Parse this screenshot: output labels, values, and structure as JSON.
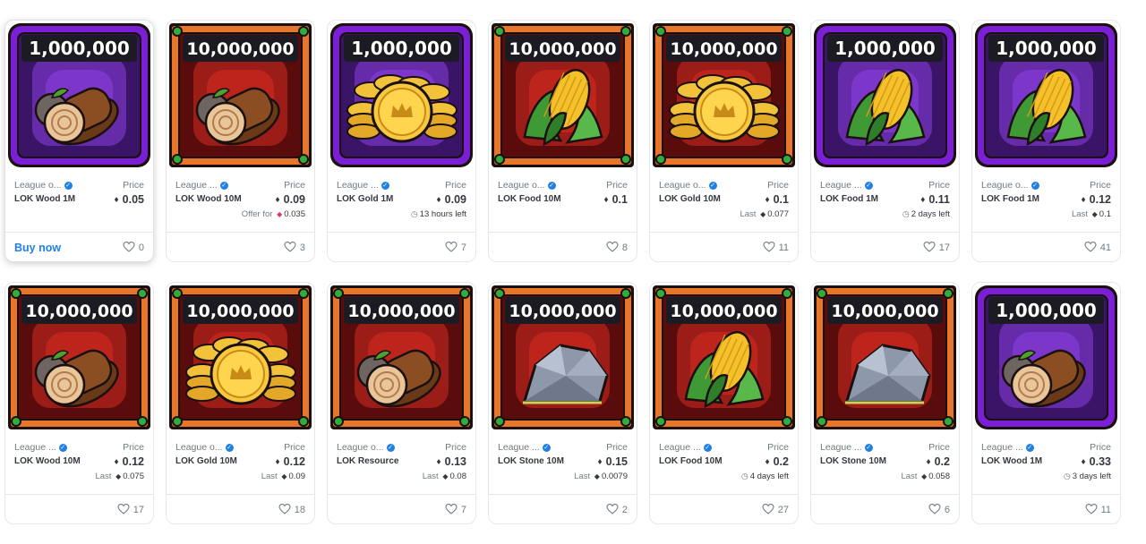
{
  "colors": {
    "accent": "#2081e2",
    "purple_frame": "#7b1fd6",
    "orange_frame": "#e8762a"
  },
  "rows": [
    [
      {
        "quantity": "1,000,000",
        "frame": "purple",
        "resource": "wood",
        "collection": "League o...",
        "name": "LOK Wood 1M",
        "price_label": "Price",
        "price": "0.05",
        "sub_prefix": "",
        "sub_value": "",
        "sub_icon": "",
        "footer_action": "Buy now",
        "likes": "0",
        "hover": true
      },
      {
        "quantity": "10,000,000",
        "frame": "orange",
        "resource": "wood",
        "collection": "League ...",
        "name": "LOK Wood 10M",
        "price_label": "Price",
        "price": "0.09",
        "sub_prefix": "Offer for",
        "sub_value": "0.035",
        "sub_icon": "weth-icon",
        "footer_action": "",
        "likes": "3",
        "hover": false
      },
      {
        "quantity": "1,000,000",
        "frame": "purple",
        "resource": "gold",
        "collection": "League ...",
        "name": "LOK Gold 1M",
        "price_label": "Price",
        "price": "0.09",
        "sub_prefix": "",
        "sub_value": "13 hours left",
        "sub_icon": "clock-icon",
        "footer_action": "",
        "likes": "7",
        "hover": false
      },
      {
        "quantity": "10,000,000",
        "frame": "orange",
        "resource": "food",
        "collection": "League o...",
        "name": "LOK Food 10M",
        "price_label": "Price",
        "price": "0.1",
        "sub_prefix": "",
        "sub_value": "",
        "sub_icon": "",
        "footer_action": "",
        "likes": "8",
        "hover": false
      },
      {
        "quantity": "10,000,000",
        "frame": "orange",
        "resource": "gold",
        "collection": "League o...",
        "name": "LOK Gold 10M",
        "price_label": "Price",
        "price": "0.1",
        "sub_prefix": "Last",
        "sub_value": "0.077",
        "sub_icon": "eth-icon",
        "footer_action": "",
        "likes": "11",
        "hover": false
      },
      {
        "quantity": "1,000,000",
        "frame": "purple",
        "resource": "food",
        "collection": "League ...",
        "name": "LOK Food 1M",
        "price_label": "Price",
        "price": "0.11",
        "sub_prefix": "",
        "sub_value": "2 days left",
        "sub_icon": "clock-icon",
        "footer_action": "",
        "likes": "17",
        "hover": false
      },
      {
        "quantity": "1,000,000",
        "frame": "purple",
        "resource": "food",
        "collection": "League o...",
        "name": "LOK Food 1M",
        "price_label": "Price",
        "price": "0.12",
        "sub_prefix": "Last",
        "sub_value": "0.1",
        "sub_icon": "eth-icon",
        "footer_action": "",
        "likes": "41",
        "hover": false
      }
    ],
    [
      {
        "quantity": "10,000,000",
        "frame": "orange",
        "resource": "wood",
        "collection": "League ...",
        "name": "LOK Wood 10M",
        "price_label": "Price",
        "price": "0.12",
        "sub_prefix": "Last",
        "sub_value": "0.075",
        "sub_icon": "eth-icon",
        "footer_action": "",
        "likes": "17",
        "hover": false
      },
      {
        "quantity": "10,000,000",
        "frame": "orange",
        "resource": "gold",
        "collection": "League o...",
        "name": "LOK Gold 10M",
        "price_label": "Price",
        "price": "0.12",
        "sub_prefix": "Last",
        "sub_value": "0.09",
        "sub_icon": "eth-icon",
        "footer_action": "",
        "likes": "18",
        "hover": false
      },
      {
        "quantity": "10,000,000",
        "frame": "orange",
        "resource": "wood",
        "collection": "League o...",
        "name": "LOK Resource",
        "price_label": "Price",
        "price": "0.13",
        "sub_prefix": "Last",
        "sub_value": "0.08",
        "sub_icon": "eth-icon",
        "footer_action": "",
        "likes": "7",
        "hover": false
      },
      {
        "quantity": "10,000,000",
        "frame": "orange",
        "resource": "stone",
        "collection": "League ...",
        "name": "LOK Stone 10M",
        "price_label": "Price",
        "price": "0.15",
        "sub_prefix": "Last",
        "sub_value": "0.0079",
        "sub_icon": "eth-icon",
        "footer_action": "",
        "likes": "2",
        "hover": false
      },
      {
        "quantity": "10,000,000",
        "frame": "orange",
        "resource": "food",
        "collection": "League ...",
        "name": "LOK Food 10M",
        "price_label": "Price",
        "price": "0.2",
        "sub_prefix": "",
        "sub_value": "4 days left",
        "sub_icon": "clock-icon",
        "footer_action": "",
        "likes": "27",
        "hover": false
      },
      {
        "quantity": "10,000,000",
        "frame": "orange",
        "resource": "stone",
        "collection": "League ...",
        "name": "LOK Stone 10M",
        "price_label": "Price",
        "price": "0.2",
        "sub_prefix": "Last",
        "sub_value": "0.058",
        "sub_icon": "eth-icon",
        "footer_action": "",
        "likes": "6",
        "hover": false
      },
      {
        "quantity": "1,000,000",
        "frame": "purple",
        "resource": "wood",
        "collection": "League ...",
        "name": "LOK Wood 1M",
        "price_label": "Price",
        "price": "0.33",
        "sub_prefix": "",
        "sub_value": "3 days left",
        "sub_icon": "clock-icon",
        "footer_action": "",
        "likes": "11",
        "hover": false
      }
    ]
  ]
}
